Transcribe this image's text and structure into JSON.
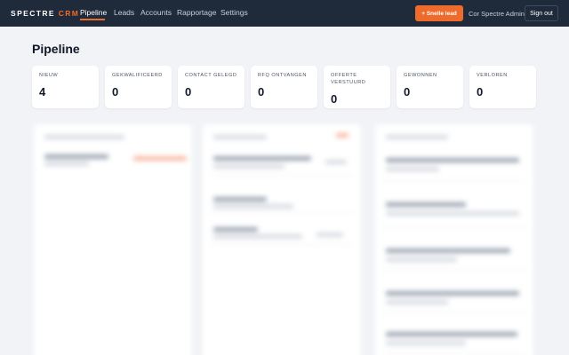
{
  "header": {
    "brand_main": "SPECTRE",
    "brand_accent": "CRM",
    "nav": [
      "Pipeline",
      "Leads",
      "Accounts",
      "Rapportage",
      "Settings"
    ],
    "active_nav": "Pipeline",
    "quick_lead_label": "+ Snelle lead",
    "user_name": "Cor Spectre Admin",
    "sign_out_label": "Sign out"
  },
  "page": {
    "title": "Pipeline"
  },
  "stats": [
    {
      "label": "NIEUW",
      "value": "4"
    },
    {
      "label": "GEKWALIFICEERD",
      "value": "0"
    },
    {
      "label": "CONTACT GELEGD",
      "value": "0"
    },
    {
      "label": "RFQ ONTVANGEN",
      "value": "0"
    },
    {
      "label": "OFFERTE VERSTUURD",
      "value": "0"
    },
    {
      "label": "GEWONNEN",
      "value": "0"
    },
    {
      "label": "VERLOREN",
      "value": "0"
    }
  ],
  "colors": {
    "header_bg": "#1f2a3a",
    "accent": "#ee6b2c",
    "page_bg": "#f1f3f6"
  }
}
